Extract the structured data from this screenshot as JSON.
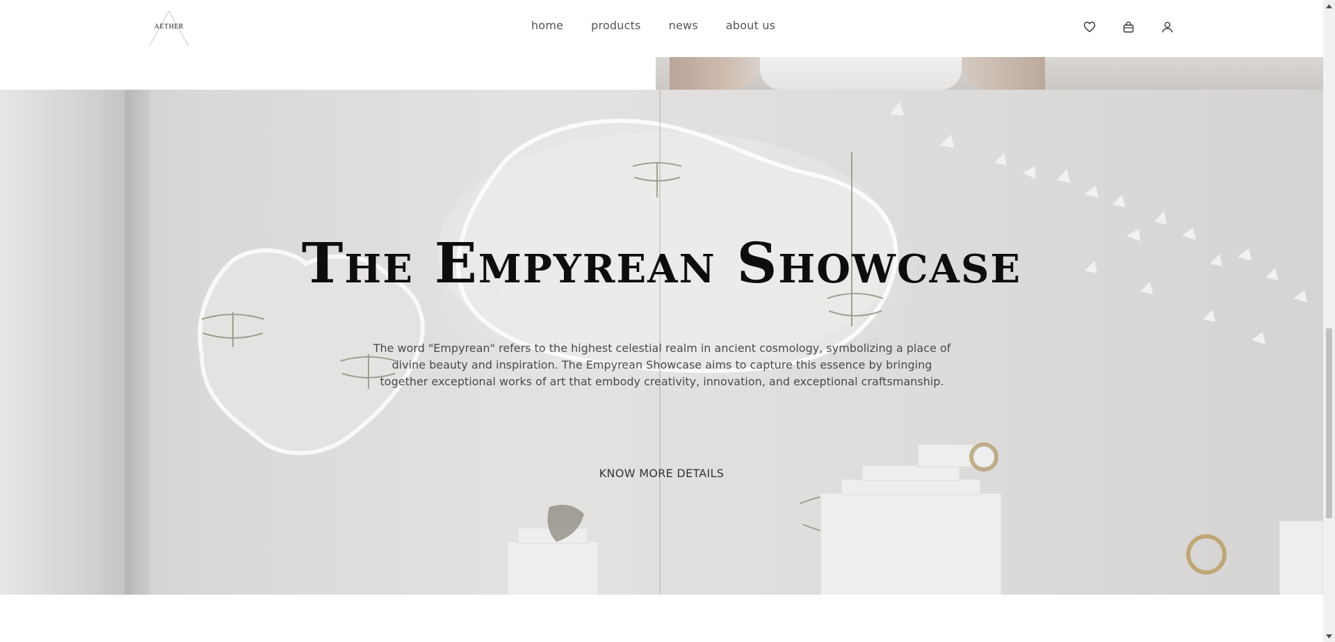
{
  "header": {
    "logo_text": "AETHER",
    "nav": [
      {
        "label": "home"
      },
      {
        "label": "products"
      },
      {
        "label": "news"
      },
      {
        "label": "about us"
      }
    ],
    "icons": [
      "heart-icon",
      "shopping-bag-icon",
      "user-icon"
    ]
  },
  "hero": {
    "title": "The Empyrean Showcase",
    "description": "The word \"Empyrean\" refers to the highest celestial realm in ancient cosmology, symbolizing a place of divine beauty and inspiration. The Empyrean Showcase aims to capture this essence by bringing together exceptional works of art that embody creativity, innovation, and exceptional craftsmanship.",
    "cta_label": "KNOW MORE DETAILS"
  },
  "colors": {
    "title": "#0d0d0d",
    "text": "#4a4a4a",
    "nav_text": "#555555",
    "background": "#ffffff"
  }
}
